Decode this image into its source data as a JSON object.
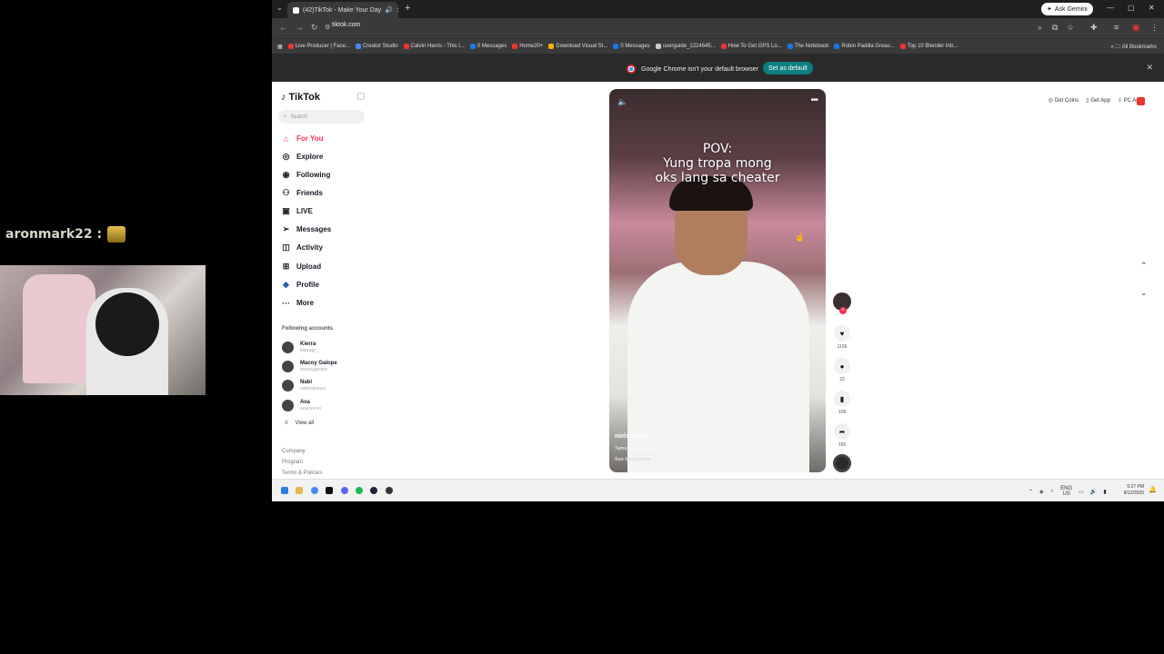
{
  "overlay": {
    "username": "aronmark22 :"
  },
  "browser": {
    "tab_title": "(42)TikTok - Make Your Day",
    "url": "tiktok.com",
    "ask_gemini": "Ask Gemini",
    "bookmarks": [
      "Live Producer | Face...",
      "Creator Studio",
      "Calvin Harris - This I...",
      "0 Messages",
      "Home20+",
      "Download Visual St...",
      "0 Messages",
      "userguide_1224645...",
      "How To Get GPS Lo...",
      "The Notebook",
      "Robin Padilla Greas...",
      "Top 10 Blender Intr..."
    ],
    "all_bookmarks": "All Bookmarks",
    "infobar": {
      "message": "Google Chrome isn't your default browser",
      "button": "Set as default"
    }
  },
  "tiktok": {
    "logo": "TikTok",
    "search_placeholder": "Search",
    "nav": [
      {
        "label": "For You"
      },
      {
        "label": "Explore"
      },
      {
        "label": "Following"
      },
      {
        "label": "Friends"
      },
      {
        "label": "LIVE"
      },
      {
        "label": "Messages"
      },
      {
        "label": "Activity"
      },
      {
        "label": "Upload"
      },
      {
        "label": "Profile"
      },
      {
        "label": "More"
      }
    ],
    "following_title": "Following accounts",
    "accounts": [
      {
        "name": "Kierra",
        "handle": "kierragc_"
      },
      {
        "name": "Macoy Galope",
        "handle": "macoygalope"
      },
      {
        "name": "Nabi",
        "handle": "nabimaniass"
      },
      {
        "name": "Ava",
        "handle": "avacuervo"
      }
    ],
    "view_all": "View all",
    "footer": [
      "Company",
      "Program",
      "Terms & Policies"
    ],
    "top_links": [
      "Get Coins",
      "Get App",
      "PC App"
    ],
    "video": {
      "caption": [
        "POV:",
        "Yung tropa mong",
        "oks lang sa cheater"
      ],
      "username": "nielson985",
      "description": "Tama bayon baha",
      "see_translation": "See translation"
    },
    "actions": {
      "likes": "1106",
      "comments": "22",
      "saves": "108",
      "shares": "165"
    }
  },
  "system": {
    "lang": "ENG",
    "region": "US",
    "time": "5:27 PM",
    "date": "8/12/2026"
  },
  "colors": {
    "accent": "#fe2c55",
    "teal": "#0e7f80"
  }
}
